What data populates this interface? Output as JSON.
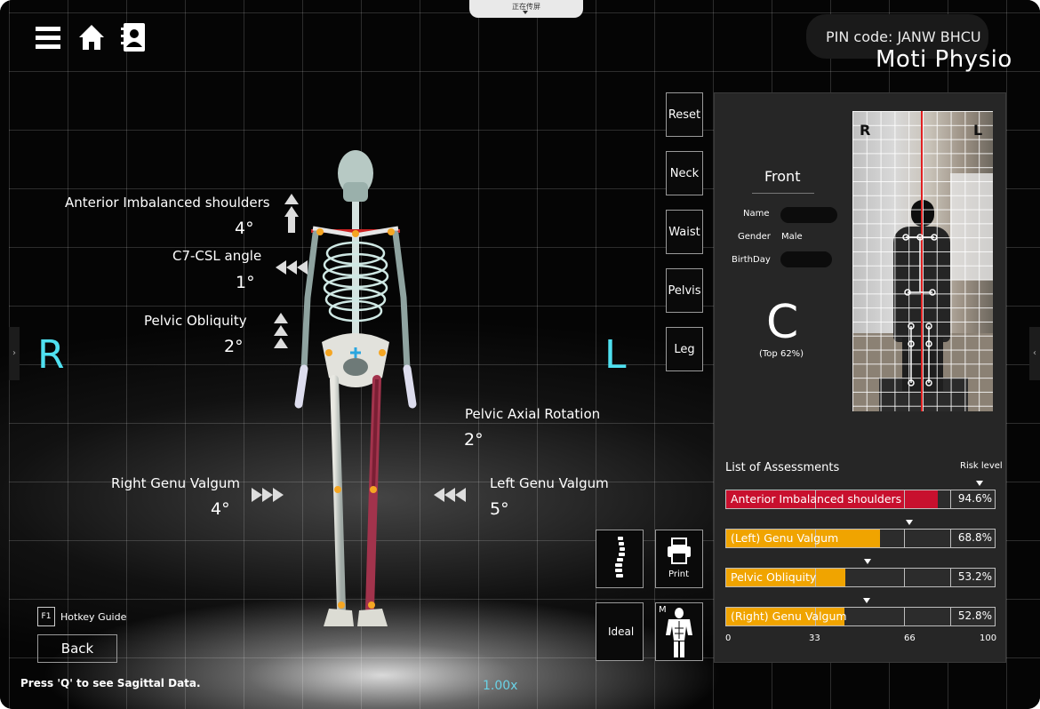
{
  "top_tab": {
    "label": "正在传屏"
  },
  "header": {
    "pin_text": "PIN code: JANW BHCU",
    "brand": "Moti Physio"
  },
  "icons": {
    "menu": "menu-icon",
    "home": "home-icon",
    "contacts": "contacts-icon"
  },
  "annotations": [
    {
      "id": "anterior",
      "label": "Anterior Imbalanced shoulders",
      "value": "4°"
    },
    {
      "id": "c7",
      "label": "C7-CSL angle",
      "value": "1°"
    },
    {
      "id": "pelvic_obliquity",
      "label": "Pelvic Obliquity",
      "value": "2°"
    },
    {
      "id": "pelvic_axial",
      "label": "Pelvic Axial Rotation",
      "value": "2°"
    },
    {
      "id": "right_genu",
      "label": "Right Genu Valgum",
      "value": "4°"
    },
    {
      "id": "left_genu",
      "label": "Left Genu Valgum",
      "value": "5°"
    }
  ],
  "sides": {
    "right": "R",
    "left": "L"
  },
  "side_buttons": [
    "Reset",
    "Neck",
    "Waist",
    "Pelvis",
    "Leg"
  ],
  "panel": {
    "title": "Front",
    "name_label": "Name",
    "gender_label": "Gender",
    "gender_value": "Male",
    "birthday_label": "BirthDay",
    "grade": "C",
    "grade_sub": "(Top 62%)",
    "photo_r": "R",
    "photo_l": "L"
  },
  "assessments": {
    "title": "List of Assessments",
    "risk_title": "Risk level",
    "items": [
      {
        "name": "Anterior Imbalanced shoulders",
        "pct": "94.6%",
        "value": 94.6,
        "color": "#c8102e"
      },
      {
        "name": "(Left) Genu Valgum",
        "pct": "68.8%",
        "value": 68.8,
        "color": "#f0a400"
      },
      {
        "name": "Pelvic Obliquity",
        "pct": "53.2%",
        "value": 53.2,
        "color": "#f0a400"
      },
      {
        "name": "(Right) Genu Valgum",
        "pct": "52.8%",
        "value": 52.8,
        "color": "#f0a400"
      }
    ],
    "scale": [
      "0",
      "33",
      "66",
      "100"
    ]
  },
  "tools": {
    "print_label": "Print",
    "ideal_label": "Ideal",
    "muscle_badge": "M"
  },
  "footer": {
    "f1": "F1",
    "hotkey": "Hotkey Guide",
    "back": "Back",
    "press_q": "Press 'Q' to see Sagittal Data.",
    "zoom": "1.00x"
  }
}
